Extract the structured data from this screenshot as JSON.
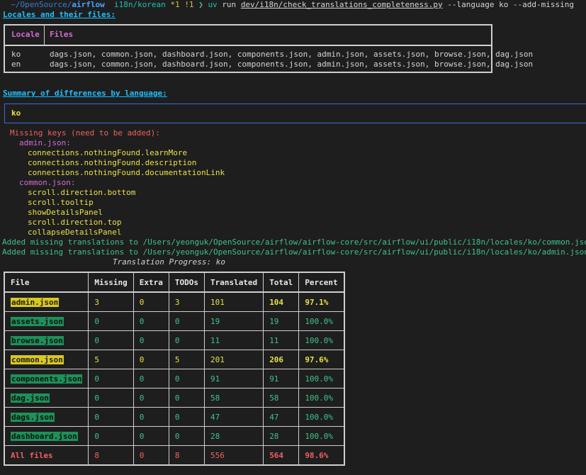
{
  "prompt": {
    "apple_glyph": "",
    "folder_glyph": "",
    "path_prefix": "~/OpenSource/",
    "path_dir": "airflow",
    "git_glyph": "",
    "branch": "i18n/korean",
    "status_modified": "*1",
    "status_untracked": "!1",
    "prompt_char": "❯",
    "cmd_uv": "uv",
    "cmd_run": "run",
    "cmd_script": "dev/i18n/check_translations_completeness.py",
    "cmd_args": "--language ko --add-missing"
  },
  "locales_heading": "Locales and their files:",
  "locales_table": {
    "headers": [
      "Locale",
      "Files"
    ],
    "rows": [
      {
        "locale": "ko",
        "files": "dags.json, common.json, dashboard.json, components.json, admin.json, assets.json, browse.json, dag.json"
      },
      {
        "locale": "en",
        "files": "dags.json, common.json, dashboard.json, components.json, admin.json, assets.json, browse.json, dag.json"
      }
    ]
  },
  "summary_heading": "Summary of differences by language:",
  "panel_language": "ko",
  "missing": {
    "title": "Missing keys (need to be added):",
    "groups": [
      {
        "file": "admin.json:",
        "keys": [
          "connections.nothingFound.learnMore",
          "connections.nothingFound.description",
          "connections.nothingFound.documentationLink"
        ]
      },
      {
        "file": "common.json:",
        "keys": [
          "scroll.direction.bottom",
          "scroll.tooltip",
          "showDetailsPanel",
          "scroll.direction.top",
          "collapseDetailsPanel"
        ]
      }
    ]
  },
  "added_lines": [
    "Added missing translations to /Users/yeonguk/OpenSource/airflow/airflow-core/src/airflow/ui/public/i18n/locales/ko/common.json",
    "Added missing translations to /Users/yeonguk/OpenSource/airflow/airflow-core/src/airflow/ui/public/i18n/locales/ko/admin.json"
  ],
  "progress_title": "Translation Progress: ko",
  "progress_table": {
    "headers": [
      "File",
      "Missing",
      "Extra",
      "TODOs",
      "Translated",
      "Total",
      "Percent"
    ],
    "rows": [
      {
        "file": "admin.json",
        "missing": "3",
        "extra": "0",
        "todos": "3",
        "translated": "101",
        "total": "104",
        "percent": "97.1%",
        "status": "incomplete"
      },
      {
        "file": "assets.json",
        "missing": "0",
        "extra": "0",
        "todos": "0",
        "translated": "19",
        "total": "19",
        "percent": "100.0%",
        "status": "complete"
      },
      {
        "file": "browse.json",
        "missing": "0",
        "extra": "0",
        "todos": "0",
        "translated": "11",
        "total": "11",
        "percent": "100.0%",
        "status": "complete"
      },
      {
        "file": "common.json",
        "missing": "5",
        "extra": "0",
        "todos": "5",
        "translated": "201",
        "total": "206",
        "percent": "97.6%",
        "status": "incomplete"
      },
      {
        "file": "components.json",
        "missing": "0",
        "extra": "0",
        "todos": "0",
        "translated": "91",
        "total": "91",
        "percent": "100.0%",
        "status": "complete"
      },
      {
        "file": "dag.json",
        "missing": "0",
        "extra": "0",
        "todos": "0",
        "translated": "58",
        "total": "58",
        "percent": "100.0%",
        "status": "complete"
      },
      {
        "file": "dags.json",
        "missing": "0",
        "extra": "0",
        "todos": "0",
        "translated": "47",
        "total": "47",
        "percent": "100.0%",
        "status": "complete"
      },
      {
        "file": "dashboard.json",
        "missing": "0",
        "extra": "0",
        "todos": "0",
        "translated": "28",
        "total": "28",
        "percent": "100.0%",
        "status": "complete"
      }
    ],
    "total_row": {
      "file": "All files",
      "missing": "8",
      "extra": "0",
      "todos": "8",
      "translated": "556",
      "total": "564",
      "percent": "98.6%"
    }
  },
  "colors": {
    "background": "#1e1e1e",
    "yellow_highlight": "#d9c821",
    "green_highlight": "#1d9159",
    "red_text": "#f06060",
    "panel_border": "#3c6bd8"
  }
}
